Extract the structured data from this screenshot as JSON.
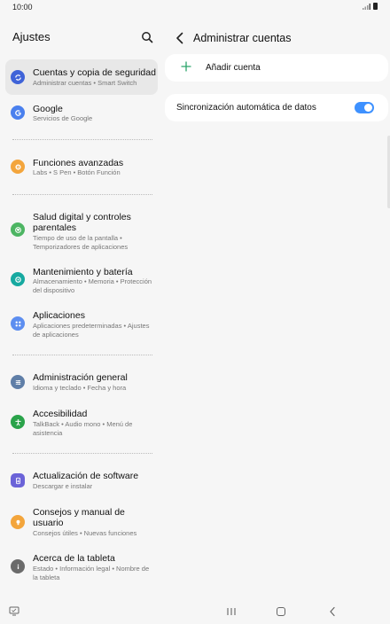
{
  "status_bar": {
    "time": "10:00"
  },
  "left_pane": {
    "title": "Ajustes",
    "items": [
      {
        "title": "Cuentas y copia de seguridad",
        "subtitle": "Administrar cuentas  •  Smart Switch",
        "icon": "sync-icon",
        "color": "#3f63d8"
      },
      {
        "title": "Google",
        "subtitle": "Servicios de Google",
        "icon": "google-icon",
        "color": "#4a80ee"
      },
      {
        "title": "Funciones avanzadas",
        "subtitle": "Labs  •  S Pen  •  Botón Función",
        "icon": "gear-icon",
        "color": "#f3a53c"
      },
      {
        "title": "Salud digital y controles parentales",
        "subtitle": "Tiempo de uso de la pantalla  •  Temporizadores de aplicaciones",
        "icon": "heart-icon",
        "color": "#4db563"
      },
      {
        "title": "Mantenimiento y batería",
        "subtitle": "Almacenamiento  •  Memoria  •  Protección del dispositivo",
        "icon": "maintenance-icon",
        "color": "#16a9a0"
      },
      {
        "title": "Aplicaciones",
        "subtitle": "Aplicaciones predeterminadas  •  Ajustes de aplicaciones",
        "icon": "apps-icon",
        "color": "#5d8ef0"
      },
      {
        "title": "Administración general",
        "subtitle": "Idioma y teclado  •  Fecha y hora",
        "icon": "sliders-icon",
        "color": "#5f7ea7"
      },
      {
        "title": "Accesibilidad",
        "subtitle": "TalkBack  •  Audio mono  •  Menú de asistencia",
        "icon": "accessibility-icon",
        "color": "#2aa34a"
      },
      {
        "title": "Actualización de software",
        "subtitle": "Descargar e instalar",
        "icon": "update-icon",
        "color": "#6b63d8"
      },
      {
        "title": "Consejos y manual de usuario",
        "subtitle": "Consejos útiles  •  Nuevas funciones",
        "icon": "bulb-icon",
        "color": "#f3a53c"
      },
      {
        "title": "Acerca de la tableta",
        "subtitle": "Estado  •  Información legal  •  Nombre de la tableta",
        "icon": "info-icon",
        "color": "#6b6b6b"
      }
    ]
  },
  "right_pane": {
    "title": "Administrar cuentas",
    "add_account": "Añadir cuenta",
    "sync_label": "Sincronización automática de datos",
    "accent": "#3e91ff",
    "add_color": "#2ba46b"
  }
}
